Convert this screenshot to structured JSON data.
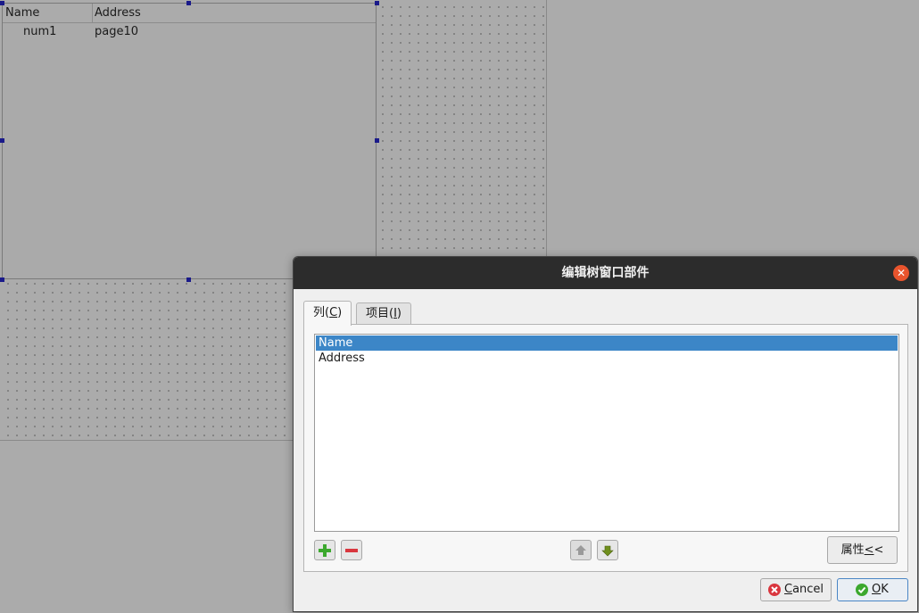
{
  "tree_preview": {
    "columns": [
      "Name",
      "Address"
    ],
    "rows": [
      {
        "name": "num1",
        "address": "page10"
      }
    ]
  },
  "dialog": {
    "title": "编辑树窗口部件",
    "tabs": [
      {
        "label": "列(",
        "mnemonic": "C",
        "suffix": ")",
        "active": true
      },
      {
        "label": "项目(",
        "mnemonic": "I",
        "suffix": ")",
        "active": false
      }
    ],
    "column_list": {
      "items": [
        "Name",
        "Address"
      ],
      "selected_index": 0
    },
    "properties_button": {
      "label": "属性",
      "mnemonic": "<",
      "suffix": "<"
    },
    "cancel_button": {
      "mnemonic": "C",
      "rest": "ancel"
    },
    "ok_button": {
      "mnemonic": "O",
      "rest": "K"
    }
  },
  "colors": {
    "selection": "#3c86c7",
    "close": "#e9542d",
    "add_icon": "#3ca82e",
    "remove_icon": "#d9363e",
    "arrow_icon": "#6f8f1c"
  },
  "icons": {
    "close": "close-icon",
    "add": "plus-icon",
    "remove": "minus-icon",
    "up": "arrow-up-icon",
    "down": "arrow-down-icon",
    "cancel": "cancel-icon",
    "ok": "check-icon"
  }
}
